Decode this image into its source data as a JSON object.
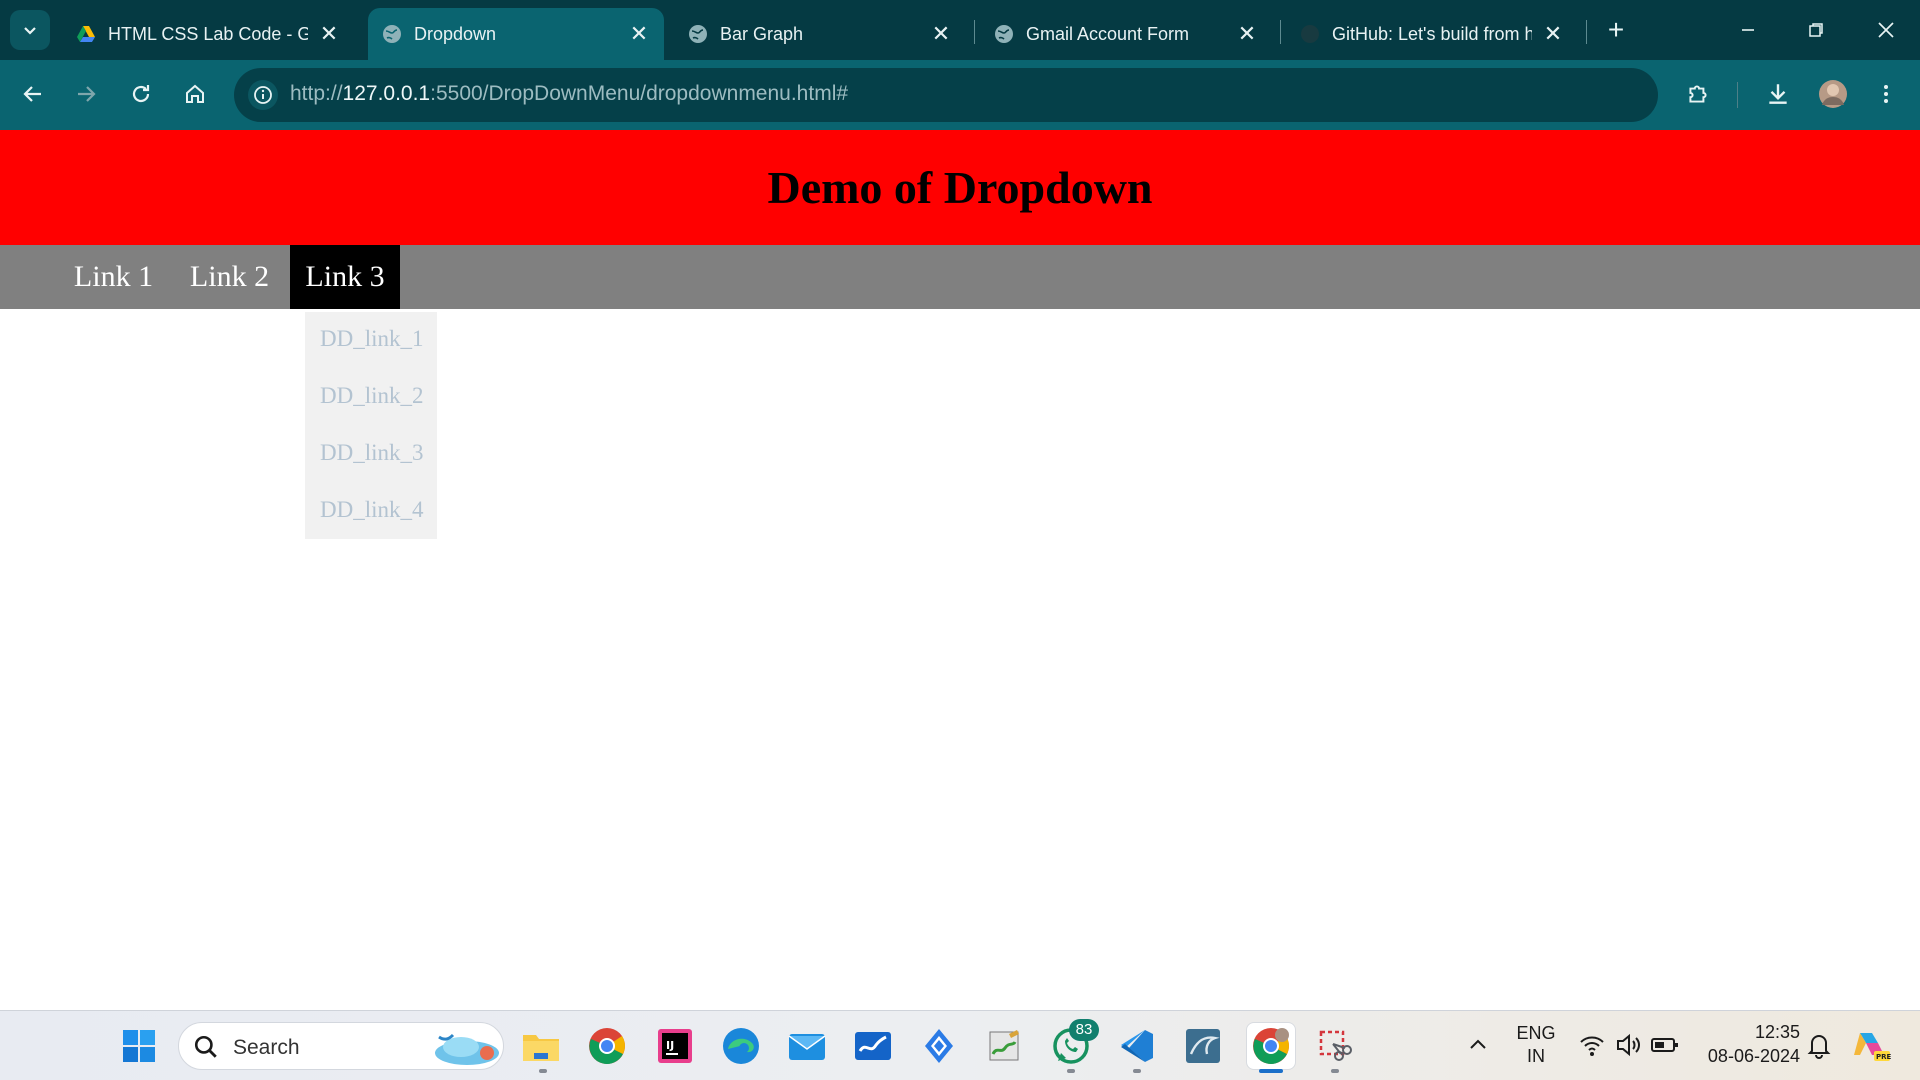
{
  "browser": {
    "tabs": [
      {
        "title": "HTML CSS Lab Code - Go",
        "icon": "drive-icon",
        "active": false
      },
      {
        "title": "Dropdown",
        "icon": "globe-icon",
        "active": true
      },
      {
        "title": "Bar Graph",
        "icon": "globe-icon",
        "active": false
      },
      {
        "title": "Gmail Account Form",
        "icon": "globe-icon",
        "active": false
      },
      {
        "title": "GitHub: Let's build from h",
        "icon": "github-icon",
        "active": false
      }
    ],
    "new_tab_label": "+",
    "url_scheme": "http://",
    "url_host": "127.0.0.1",
    "url_rest": ":5500/DropDownMenu/dropdownmenu.html#"
  },
  "page": {
    "title": "Demo of Dropdown",
    "nav": [
      "Link 1",
      "Link 2",
      "Link 3"
    ],
    "active_nav": "Link 3",
    "dropdown": [
      "DD_link_1",
      "DD_link_2",
      "DD_link_3",
      "DD_link_4"
    ],
    "colors": {
      "header": "#ff0000",
      "navbar": "#808080",
      "active_nav": "#000000",
      "dropdown_bg": "#f1f1f1",
      "dropdown_text": "#b3c3d1"
    }
  },
  "taskbar": {
    "search_label": "Search",
    "whatsapp_badge": "83",
    "lang_top": "ENG",
    "lang_bottom": "IN",
    "time": "12:35",
    "date": "08-06-2024"
  }
}
